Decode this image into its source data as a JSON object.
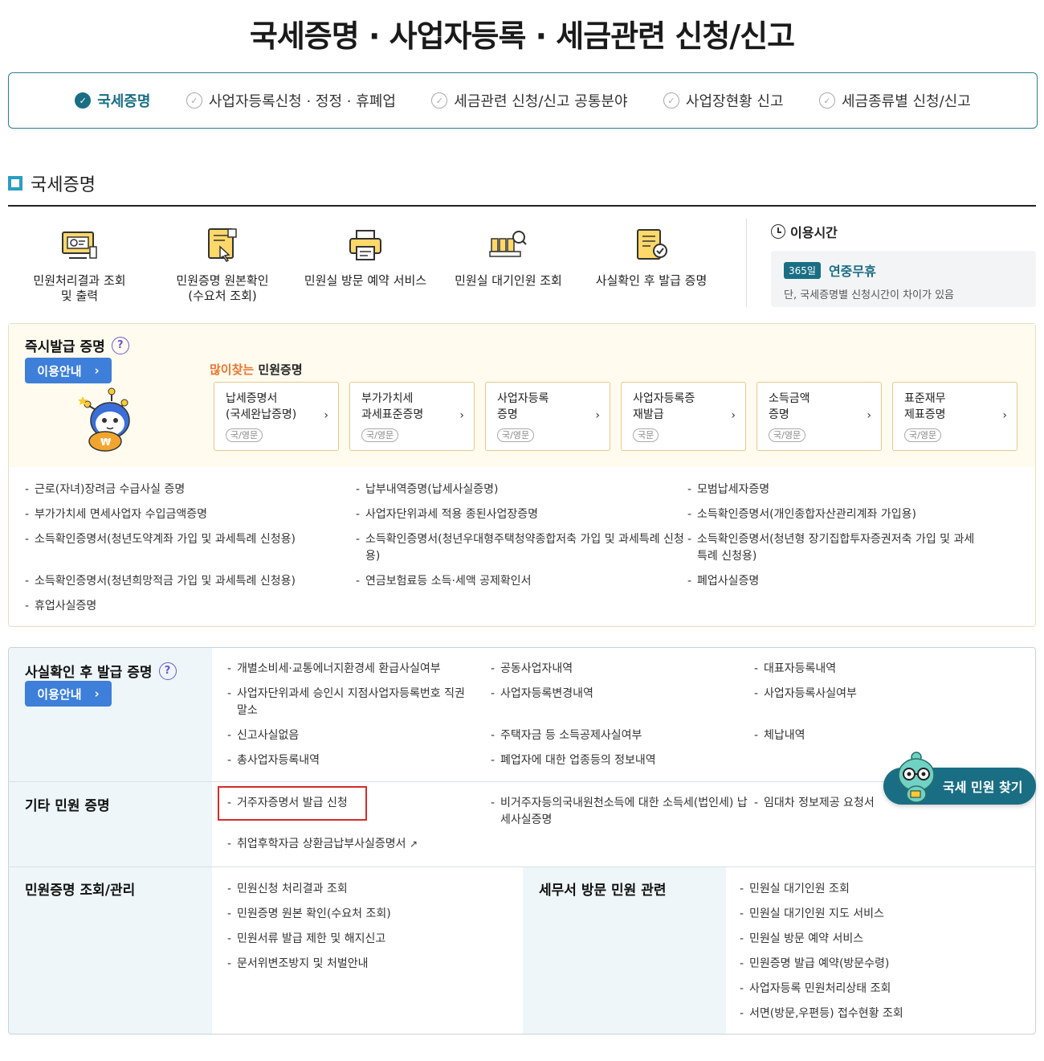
{
  "page": {
    "title": "국세증명 · 사업자등록 · 세금관련 신청/신고"
  },
  "tabs": [
    {
      "label": "국세증명",
      "active": true
    },
    {
      "label": "사업자등록신청 · 정정 · 휴폐업",
      "active": false
    },
    {
      "label": "세금관련 신청/신고 공통분야",
      "active": false
    },
    {
      "label": "사업장현황 신고",
      "active": false
    },
    {
      "label": "세금종류별 신청/신고",
      "active": false
    }
  ],
  "section": {
    "heading": "국세증명"
  },
  "quick_links": [
    {
      "label": "민원처리결과 조회\n및 출력",
      "icon": "monitor-result-icon"
    },
    {
      "label": "민원증명 원본확인\n(수요처 조회)",
      "icon": "document-touch-icon"
    },
    {
      "label": "민원실 방문 예약 서비스",
      "icon": "printer-icon"
    },
    {
      "label": "민원실 대기인원 조회",
      "icon": "queue-search-icon"
    },
    {
      "label": "사실확인 후 발급 증명",
      "icon": "certificate-check-icon"
    }
  ],
  "hours": {
    "title": "이용시간",
    "badge": "365일",
    "main": "연중무휴",
    "note": "단, 국세증명별 신청시간이 차이가 있음"
  },
  "instant": {
    "title": "즉시발급 증명",
    "guide_label": "이용안내",
    "popular_prefix": "많이찾는",
    "popular_suffix": " 민원증명",
    "cards": [
      {
        "name": "납세증명서\n(국세완납증명)",
        "chip": "국/영문"
      },
      {
        "name": "부가가치세\n과세표준증명",
        "chip": "국/영문"
      },
      {
        "name": "사업자등록\n증명",
        "chip": "국/영문"
      },
      {
        "name": "사업자등록증\n재발급",
        "chip": "국문"
      },
      {
        "name": "소득금액\n증명",
        "chip": "국/영문"
      },
      {
        "name": "표준재무\n제표증명",
        "chip": "국/영문"
      }
    ],
    "col1": [
      "근로(자녀)장려금 수급사실 증명",
      "부가가치세 면세사업자 수입금액증명",
      "소득확인증명서(청년도약계좌 가입 및 과세특례 신청용)",
      "소득확인증명서(청년희망적금 가입 및 과세특례 신청용)",
      "휴업사실증명"
    ],
    "col2": [
      "납부내역증명(납세사실증명)",
      "사업자단위과세 적용 종된사업장증명",
      "소득확인증명서(청년우대형주택청약종합저축 가입 및 과세특례 신청용)",
      "연금보험료등 소득·세액 공제확인서"
    ],
    "col3": [
      "모범납세자증명",
      "소득확인증명서(개인종합자산관리계좌 가입용)",
      "소득확인증명서(청년형 장기집합투자증권저축 가입 및 과세특례 신청용)",
      "폐업사실증명"
    ]
  },
  "after_check": {
    "title": "사실확인 후 발급 증명",
    "guide_label": "이용안내",
    "col1": [
      "개별소비세·교통에너지환경세 환급사실여부",
      "사업자단위과세 승인시 지점사업자등록번호 직권말소",
      "신고사실없음",
      "총사업자등록내역"
    ],
    "col2": [
      "공동사업자내역",
      "사업자등록변경내역",
      "주택자금 등 소득공제사실여부",
      "폐업자에 대한 업종등의 정보내역"
    ],
    "col3": [
      "대표자등록내역",
      "사업자등록사실여부",
      "체납내역"
    ]
  },
  "other": {
    "title": "기타 민원 증명",
    "col1": [
      "거주자증명서 발급 신청",
      "취업후학자금 상환금납부사실증명서"
    ],
    "col2": [
      "비거주자등의국내원천소득에 대한 소득세(법인세) 납세사실증명"
    ],
    "col3": [
      "임대차 정보제공 요청서"
    ]
  },
  "manage": {
    "title": "민원증명 조회/관리",
    "items": [
      "민원신청 처리결과 조회",
      "민원증명 원본 확인(수요처 조회)",
      "민원서류 발급 제한 및 해지신고",
      "문서위변조방지 및 처벌안내"
    ]
  },
  "visit": {
    "title": "세무서 방문 민원 관련",
    "items": [
      "민원실 대기인원 조회",
      "민원실 대기인원 지도 서비스",
      "민원실 방문 예약 서비스",
      "민원증명 발급 예약(방문수령)",
      "사업자등록 민원처리상태 조회",
      "서면(방문,우편등) 접수현황 조회"
    ]
  },
  "fab": {
    "label": "국세 민원 찾기"
  },
  "colors": {
    "accent": "#1a6e84",
    "guide_button": "#3d7fd9",
    "highlight": "#d62b2b",
    "popular": "#e8772e"
  }
}
